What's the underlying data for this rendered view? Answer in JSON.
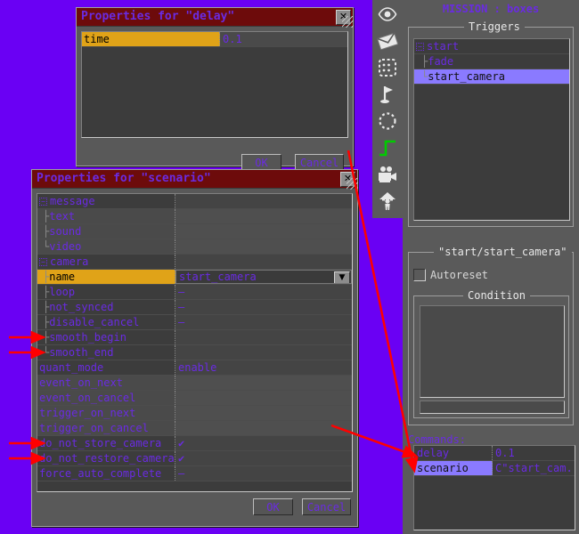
{
  "theme": {
    "desktop_bg": "#6a00f4",
    "panel_bg": "#5a5a5a",
    "grid_bg": "#3c3c3c",
    "title_bg": "#6d0b0b",
    "text_violet": "#6a2be2",
    "selection_gold": "#e0a318",
    "selection_blue": "#8a7aff",
    "annotation_red": "#ff0000"
  },
  "delay_window": {
    "title": "Properties for \"delay\"",
    "close_label": "✕",
    "rows": [
      {
        "name": "time",
        "value": "0.1",
        "selected": true
      }
    ],
    "ok_label": "OK",
    "cancel_label": "Cancel"
  },
  "scenario_window": {
    "title": "Properties for \"scenario\"",
    "close_label": "✕",
    "rows": [
      {
        "name": "message",
        "value": "",
        "tree": "expander",
        "depth": 0,
        "selected": false,
        "alt": false
      },
      {
        "name": "text",
        "value": "",
        "tree": "branch",
        "depth": 1,
        "selected": false,
        "alt": true
      },
      {
        "name": "sound",
        "value": "",
        "tree": "branch",
        "depth": 1,
        "selected": false,
        "alt": true
      },
      {
        "name": "video",
        "value": "",
        "tree": "last",
        "depth": 1,
        "selected": false,
        "alt": true
      },
      {
        "name": "camera",
        "value": "",
        "tree": "expander",
        "depth": 0,
        "selected": false,
        "alt": false
      },
      {
        "name": "name",
        "value": "start_camera",
        "tree": "branch",
        "depth": 1,
        "selected": true,
        "alt": false,
        "combo": true
      },
      {
        "name": "loop",
        "value": "—",
        "tree": "branch",
        "depth": 1,
        "selected": false,
        "alt": false
      },
      {
        "name": "not_synced",
        "value": "—",
        "tree": "branch",
        "depth": 1,
        "selected": false,
        "alt": false
      },
      {
        "name": "disable_cancel",
        "value": "—",
        "tree": "branch",
        "depth": 1,
        "selected": false,
        "alt": false
      },
      {
        "name": "smooth_begin",
        "value": "",
        "tree": "branch",
        "depth": 1,
        "selected": false,
        "alt": false
      },
      {
        "name": "smooth_end",
        "value": "",
        "tree": "last",
        "depth": 1,
        "selected": false,
        "alt": false
      },
      {
        "name": "quant_mode",
        "value": "enable",
        "tree": "none",
        "depth": 0,
        "selected": false,
        "alt": false
      },
      {
        "name": "event_on_next",
        "value": "",
        "tree": "none",
        "depth": 0,
        "selected": false,
        "alt": true
      },
      {
        "name": "event_on_cancel",
        "value": "",
        "tree": "none",
        "depth": 0,
        "selected": false,
        "alt": true
      },
      {
        "name": "trigger_on_next",
        "value": "",
        "tree": "none",
        "depth": 0,
        "selected": false,
        "alt": true
      },
      {
        "name": "trigger_on_cancel",
        "value": "",
        "tree": "none",
        "depth": 0,
        "selected": false,
        "alt": true
      },
      {
        "name": "do_not_store_camera",
        "value": "✔",
        "tree": "none",
        "depth": 0,
        "selected": false,
        "alt": false
      },
      {
        "name": "do_not_restore_camera",
        "value": "✔",
        "tree": "none",
        "depth": 0,
        "selected": false,
        "alt": false
      },
      {
        "name": "force_auto_complete",
        "value": "—",
        "tree": "none",
        "depth": 0,
        "selected": false,
        "alt": false
      }
    ],
    "ok_label": "OK",
    "cancel_label": "Cancel"
  },
  "toolbar": {
    "items": [
      {
        "icon": "eye-icon",
        "name": "visibility-tool"
      },
      {
        "icon": "envelope-icon",
        "name": "message-tool"
      },
      {
        "icon": "dotted-square-icon",
        "name": "zone-tool"
      },
      {
        "icon": "flag-icon",
        "name": "marker-tool"
      },
      {
        "icon": "dotted-circle-icon",
        "name": "radius-tool"
      },
      {
        "icon": "step-curve-icon",
        "name": "trigger-tool",
        "active": true
      },
      {
        "icon": "movie-camera-icon",
        "name": "camera-tool"
      },
      {
        "icon": "person-arrow-icon",
        "name": "spawn-tool"
      }
    ],
    "active_color": "#00cc00"
  },
  "mission_panel": {
    "title": "MISSION : boxes",
    "triggers_legend": "Triggers",
    "trigger_tree": [
      {
        "label": "start",
        "tree": "expander",
        "depth": 0,
        "selected": false
      },
      {
        "label": "fade",
        "tree": "branch",
        "depth": 1,
        "selected": false
      },
      {
        "label": "start_camera",
        "tree": "last",
        "depth": 1,
        "selected": true
      }
    ],
    "selected_trigger_legend": "\"start/start_camera\"",
    "autoreset_label": "Autoreset",
    "autoreset_checked": false,
    "condition_legend": "Condition",
    "condition_text": "",
    "condition_edit_text": "",
    "commands_label": "Commands:",
    "commands": [
      {
        "command": "delay",
        "value": "0.1",
        "selected": false
      },
      {
        "command": "scenario",
        "value": "C\"start_cam..",
        "selected": true
      }
    ]
  }
}
